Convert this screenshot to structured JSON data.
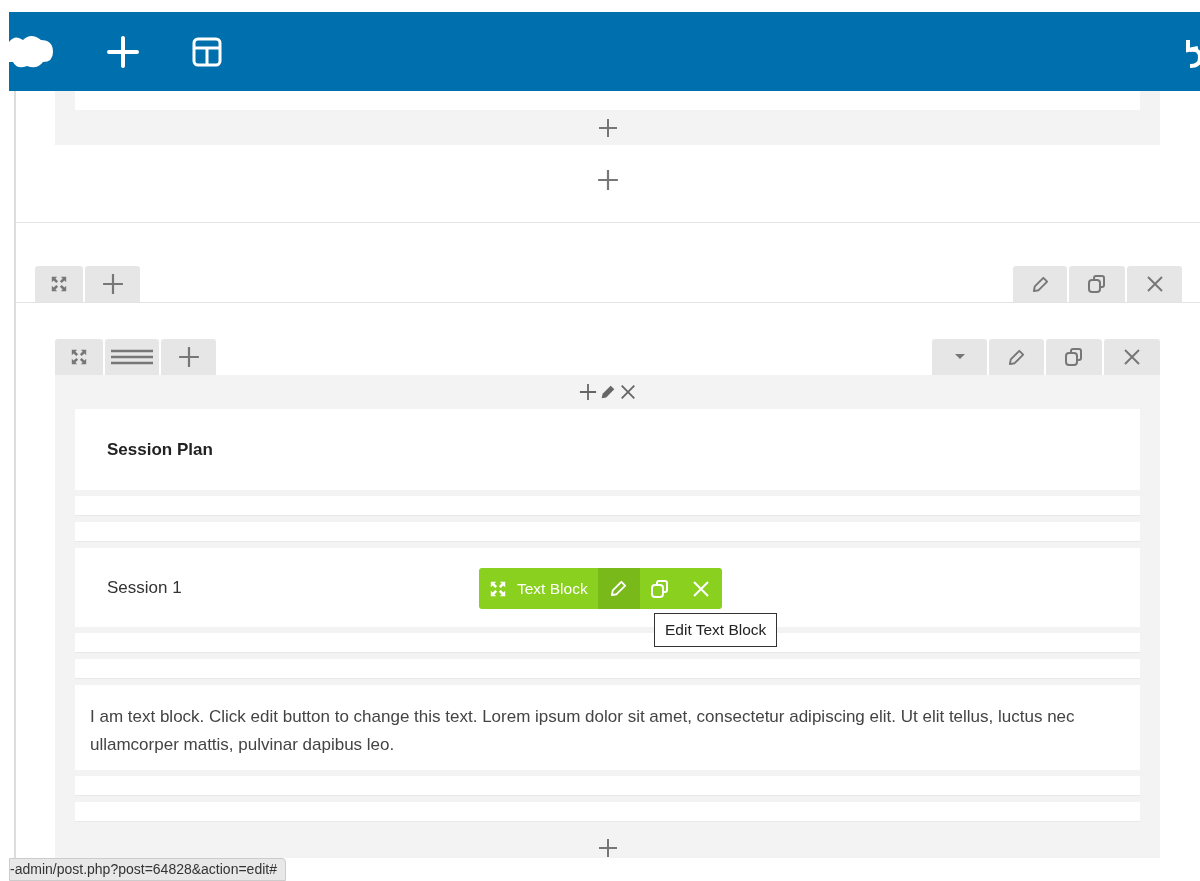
{
  "blocks": [
    {
      "kind": "heading",
      "text": "Session Plan"
    },
    {
      "kind": "text",
      "text": "Session 1",
      "toolbar": {
        "label": "Text Block",
        "tooltip": "Edit Text Block"
      }
    },
    {
      "kind": "paragraph",
      "text": "I am text block. Click edit button to change this text. Lorem ipsum dolor sit amet, consectetur adipiscing elit. Ut elit tellus, luctus nec ullamcorper mattis, pulvinar dapibus leo."
    }
  ],
  "status_bar": {
    "url": "-admin/post.php?post=64828&action=edit#"
  }
}
